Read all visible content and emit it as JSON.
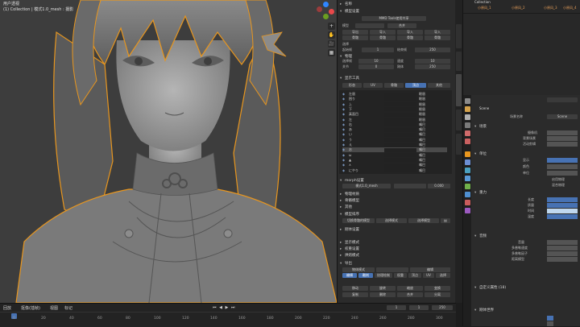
{
  "viewport": {
    "view_name": "用户透视",
    "object_info": "(1) Collection | 模式1.0_mesh : 摄影",
    "tools": [
      "+",
      "✋",
      "🎥",
      "▦"
    ]
  },
  "npanel": {
    "title_label": "名称",
    "sec_model": "模型设置",
    "mmd_tools": "MMD Tools使用共享",
    "header_cols": [
      "模型",
      "",
      "合并"
    ],
    "row1": [
      "导出",
      "导入",
      "导入",
      "导入"
    ],
    "row2": [
      "骨骼",
      "骨骼",
      "骨骼",
      "骨骼"
    ],
    "row3": [
      "骨骼",
      "骨骼",
      "骨骼",
      "骨骼"
    ],
    "sub_scene": "选择",
    "start_label": "起始帧",
    "start_val": "1",
    "end_label": "结束帧",
    "end_val": "250",
    "speed_label": "设置帧率",
    "sec_physics": "物理",
    "phys_row": [
      "选择帧",
      "10",
      "速度",
      "10"
    ],
    "phys_row2": [
      "关节",
      "0",
      "刚体",
      "250"
    ],
    "sec_display": "显示工具",
    "display_tabs": [
      "形态",
      "UV",
      "骨骼",
      "顶点",
      "其他"
    ],
    "morphs": [
      {
        "name": "左眉",
        "state": "眼眉"
      },
      {
        "name": "困り",
        "state": "眼眉"
      },
      {
        "name": "上",
        "state": "眼眉"
      },
      {
        "name": "下",
        "state": "眼眉"
      },
      {
        "name": "真面目",
        "state": "眼眉"
      },
      {
        "name": "左",
        "state": "眼眉"
      },
      {
        "name": "右",
        "state": "嘴巴"
      },
      {
        "name": "あ",
        "state": "嘴巴"
      },
      {
        "name": "い",
        "state": "嘴巴"
      },
      {
        "name": "う",
        "state": "嘴巴"
      },
      {
        "name": "え",
        "state": "嘴巴"
      },
      {
        "name": "お",
        "state": "嘴巴"
      },
      {
        "name": "ω",
        "state": "嘴巴"
      },
      {
        "name": "▲",
        "state": "嘴巴"
      },
      {
        "name": "∧",
        "state": "嘴巴"
      },
      {
        "name": "にやり",
        "state": "嘴巴"
      }
    ],
    "selected_morph": 11,
    "sec_morph_settings": "morph设置",
    "morph_target": "模式1.0_mesh",
    "morph_value": "0.000",
    "sec_material": "物理材质",
    "sec_bone": "骨骼模型",
    "sec_other": "其他",
    "sec_model_sort": "模型排序",
    "sort_btns": [
      "切换骨骼的模型",
      "选择模式",
      "选择模型"
    ],
    "sec_rigid": "刚体设置",
    "sec_vertex": "显示模式",
    "sec_weight": "权重设置",
    "sec_bake": "烘焙模式",
    "sec_export": "导出",
    "bottom_row1": [
      "物体模式",
      "",
      "编辑"
    ],
    "bottom_row2": [
      "编辑",
      "雕刻",
      "纹理绘制",
      "权重",
      "顶点",
      "UV",
      "选择"
    ],
    "bottom_row3": [
      "移动",
      "旋转",
      "缩放",
      "变换"
    ],
    "bottom_row4": [
      "复制",
      "删除",
      "合并",
      "分离"
    ]
  },
  "outliner": {
    "collection": "Collection",
    "items": [
      "小原风_1",
      "小原风_2",
      "小原风_3",
      "小原风_4"
    ]
  },
  "properties": {
    "scene_label": "Scene",
    "scene_name": "Scene",
    "sec_scene": "场景",
    "camera_label": "摄像机",
    "background_label": "背景场景",
    "active_clip_label": "活动剪辑",
    "sec_units": "单位",
    "units_type": "度量制",
    "sec_gravity": "重力",
    "sec_audio": "音频",
    "sec_rigid": "刚体世界",
    "sec_keying": "关键帧集合",
    "sec_custom": "自定义属性 (18)",
    "labels": [
      "显示",
      "颜色",
      "单位",
      "长度",
      "质量",
      "时间",
      "温度"
    ],
    "gravity_vals": [
      "0 m/s²",
      "0 m/s²",
      "-9.81 m/s²"
    ],
    "audio_labels": [
      "音量",
      "多普勒速度",
      "多普勒因子",
      "距离模型"
    ],
    "audio_vals": [
      "1.00",
      "343.3 m/s",
      "1.00",
      "反向钳制"
    ],
    "checks": [
      "启用物理",
      "混合物理"
    ]
  },
  "timeline": {
    "menus": [
      "回放",
      "抠像(插帧)",
      "视图",
      "标记"
    ],
    "current_frame": "1",
    "start": "1",
    "end": "250",
    "ticks": [
      "0",
      "20",
      "40",
      "60",
      "80",
      "100",
      "120",
      "140",
      "160",
      "180",
      "200",
      "220",
      "240",
      "260",
      "280",
      "300"
    ]
  },
  "colors": {
    "selection_blue": "#4772b3",
    "outline_orange": "#e8961e",
    "model_gray": "#8a8a8a"
  }
}
